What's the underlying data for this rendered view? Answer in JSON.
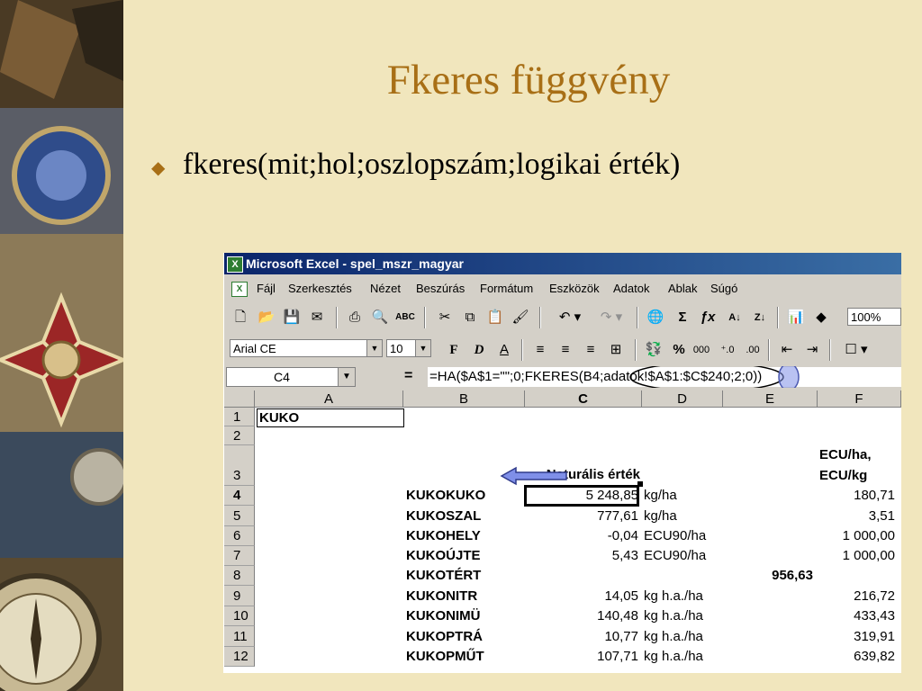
{
  "slide": {
    "title": "Fkeres függvény",
    "bullet": "fkeres(mit;hol;oszlopszám;logikai érték)"
  },
  "excel": {
    "window_title": "Microsoft Excel - spel_mszr_magyar",
    "menu": [
      "Fájl",
      "Szerkesztés",
      "Nézet",
      "Beszúrás",
      "Formátum",
      "Eszközök",
      "Adatok",
      "Ablak",
      "Súgó"
    ],
    "zoom": "100%",
    "font_name": "Arial CE",
    "font_size": "10",
    "name_box": "C4",
    "formula_part1": "=HA($A$1=\"\";0;FKERES(B4;",
    "formula_part2": "adatok!$A$1:$C$240",
    "formula_part3": ";",
    "formula_part4": "2",
    "formula_part5": ";0))",
    "columns": [
      "A",
      "B",
      "C",
      "D",
      "E",
      "F"
    ],
    "rows": [
      "1",
      "2",
      "3",
      "4",
      "5",
      "6",
      "7",
      "8",
      "9",
      "10",
      "11",
      "12"
    ],
    "cells": {
      "a1": "KUKO",
      "c3": "Naturális érték",
      "f3_line1": "ECU/ha,",
      "f3_line2": "ECU/kg",
      "data": [
        {
          "b": "KUKOKUKO",
          "c": "5 248,85",
          "d": "kg/ha",
          "f": "180,71"
        },
        {
          "b": "KUKOSZAL",
          "c": "777,61",
          "d": "kg/ha",
          "f": "3,51"
        },
        {
          "b": "KUKOHELY",
          "c": "-0,04",
          "d": "ECU90/ha",
          "f": "1 000,00"
        },
        {
          "b": "KUKOÚJTE",
          "c": "5,43",
          "d": "ECU90/ha",
          "f": "1 000,00"
        },
        {
          "b": "KUKOTÉRT",
          "c": "",
          "d": "",
          "e": "956,63",
          "f": ""
        },
        {
          "b": "KUKONITR",
          "c": "14,05",
          "d": "kg h.a./ha",
          "f": "216,72"
        },
        {
          "b": "KUKONIMÜ",
          "c": "140,48",
          "d": "kg h.a./ha",
          "f": "433,43"
        },
        {
          "b": "KUKOPTRÁ",
          "c": "10,77",
          "d": "kg h.a./ha",
          "f": "319,91"
        },
        {
          "b": "KUKOPMŰT",
          "c": "107,71",
          "d": "kg h.a./ha",
          "f": "639,82"
        }
      ]
    }
  },
  "colors": {
    "background": "#f1e6bd",
    "title": "#a86f16",
    "titlebar": "#0a246a",
    "highlight_ellipse": "#000000",
    "column_circle": "#7f8fe8"
  }
}
